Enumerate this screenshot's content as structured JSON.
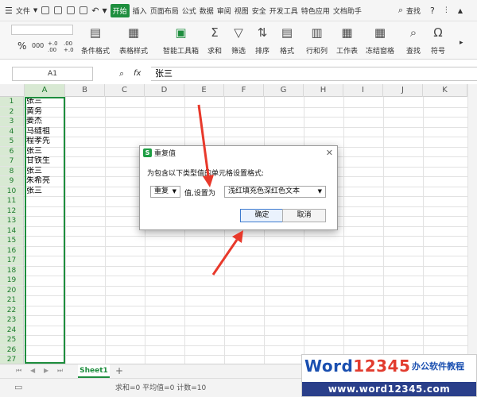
{
  "menubar": {
    "file_label": "文件",
    "items": [
      "开始",
      "插入",
      "页面布局",
      "公式",
      "数据",
      "审阅",
      "视图",
      "安全",
      "开发工具",
      "特色应用",
      "文档助手"
    ],
    "search_label": "查找"
  },
  "ribbon": {
    "number_format": "%",
    "number_codes": [
      "000",
      "+.0\n.00",
      ".00\n+.0"
    ],
    "buttons": [
      "条件格式",
      "表格样式",
      "智能工具箱",
      "求和",
      "筛选",
      "排序",
      "格式",
      "行和列",
      "工作表",
      "冻结窗格",
      "查找",
      "符号"
    ]
  },
  "formula_bar": {
    "name_box": "A1",
    "fx_label": "fx",
    "value": "张三"
  },
  "columns": [
    "A",
    "B",
    "C",
    "D",
    "E",
    "F",
    "G",
    "H",
    "I",
    "J",
    "K"
  ],
  "rows": [
    "1",
    "2",
    "3",
    "4",
    "5",
    "6",
    "7",
    "8",
    "9",
    "10",
    "11",
    "12",
    "13",
    "14",
    "15",
    "16",
    "17",
    "18",
    "19",
    "20",
    "21",
    "22",
    "23",
    "24",
    "25",
    "26",
    "27"
  ],
  "cells_a": [
    "张三",
    "黄务",
    "姜杰",
    "马缝祖",
    "程孝先",
    "张三",
    "甘铁生",
    "张三",
    "朱希亮",
    "张三"
  ],
  "sheet_tab": "Sheet1",
  "status": "求和=0  平均值=0  计数=10",
  "dialog": {
    "title": "重复值",
    "description": "为包含以下类型值的单元格设置格式:",
    "type_value": "重复",
    "value_label": "值,设置为",
    "format_value": "浅红填充色深红色文本",
    "ok_label": "确定",
    "cancel_label": "取消"
  },
  "watermark": {
    "brand_word": "Word",
    "brand_num": "12345",
    "tagline": "办公软件教程",
    "url": "www.word12345.com"
  },
  "colors": {
    "accent": "#1e8e3e",
    "arrow": "#e8392b"
  }
}
